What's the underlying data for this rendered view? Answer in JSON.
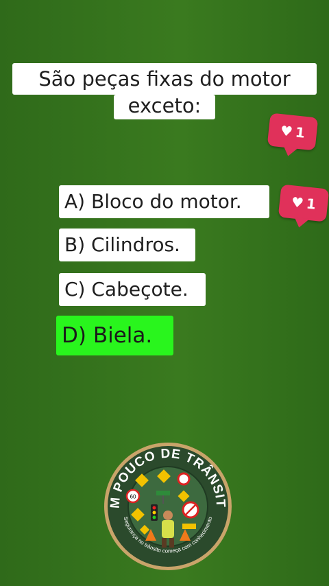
{
  "question": {
    "line1": "São peças fixas do motor",
    "line2": "exceto:"
  },
  "options": [
    {
      "label": "A) Bloco do motor."
    },
    {
      "label": "B) Cilindros."
    },
    {
      "label": "C) Cabeçote."
    },
    {
      "label": "D) Biela.",
      "highlighted": true
    }
  ],
  "reactions": [
    {
      "icon": "heart-icon",
      "count": "1"
    },
    {
      "icon": "heart-icon",
      "count": "1"
    }
  ],
  "logo": {
    "title": "UM POUCO DE TRÂNSITO",
    "slogan": "Segurança no trânsito começa com conhecimento",
    "speed_sign": "60"
  },
  "colors": {
    "background": "#347320",
    "correct_option": "#29f51d",
    "reaction": "#e0315a"
  }
}
